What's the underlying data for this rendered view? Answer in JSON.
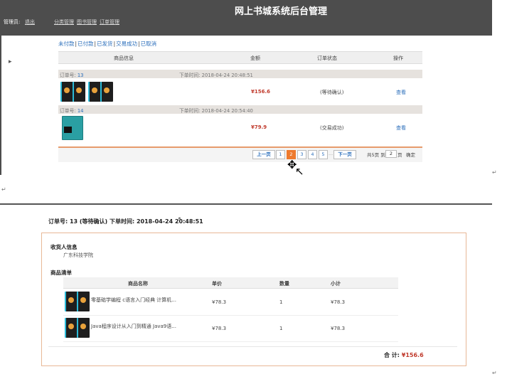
{
  "header": {
    "site_title": "网上书城系统后台管理",
    "admin_label": "管理员:",
    "logout": "退出",
    "nav": [
      "分类管理",
      "图书管理",
      "订单管理"
    ]
  },
  "filters": [
    "未付款",
    "已付款",
    "已发货",
    "交易成功",
    "已取消"
  ],
  "filter_sep": "|",
  "table_headers": {
    "product": "商品信息",
    "amount": "金额",
    "status": "订单状态",
    "action": "操作"
  },
  "orders": [
    {
      "no_label": "订单号:",
      "no": "13",
      "time_label": "下单时间:",
      "time": "2018-04-24 20:48:51",
      "amount": "¥156.6",
      "status": "(等待确认)",
      "action": "查看"
    },
    {
      "no_label": "订单号:",
      "no": "14",
      "time_label": "下单时间:",
      "time": "2018-04-24 20:54:40",
      "amount": "¥79.9",
      "status": "(交易成功)",
      "action": "查看"
    }
  ],
  "pagination": {
    "prev": "上一页",
    "pages": [
      "1",
      "2",
      "3",
      "4",
      "5"
    ],
    "current_page": 2,
    "ellipsis": "...",
    "next": "下一页",
    "total_text": "共5页 到",
    "goto_value": "2",
    "page_unit": "页",
    "confirm": "确定"
  },
  "para_mark": "↵",
  "detail": {
    "header": "订单号: 13 (等待确认) 下单时间: 2018-04-24 20:48:51",
    "receiver_title": "收货人信息",
    "receiver": "广东科技学院",
    "list_title": "商品清单",
    "columns": {
      "name": "商品名称",
      "price": "单价",
      "qty": "数量",
      "subtotal": "小计"
    },
    "items": [
      {
        "name": "零基础学编程 c语言入门经典 计算机...",
        "price": "¥78.3",
        "qty": "1",
        "subtotal": "¥78.3"
      },
      {
        "name": "Java程序设计从入门到精通 Java9语...",
        "price": "¥78.3",
        "qty": "1",
        "subtotal": "¥78.3"
      }
    ],
    "total_label": "合 计:",
    "total_value": "¥156.6"
  },
  "icons": [
    "arrow-cursor-icon",
    "move-cursor-icon",
    "pointer-cursor-icon",
    "book-cover-icon"
  ],
  "colors": {
    "topbar": "#4d4d4d",
    "link": "#2a6ebb",
    "price": "#c0392b",
    "active_page": "#ee7a2e",
    "box_border": "#e8b896"
  }
}
